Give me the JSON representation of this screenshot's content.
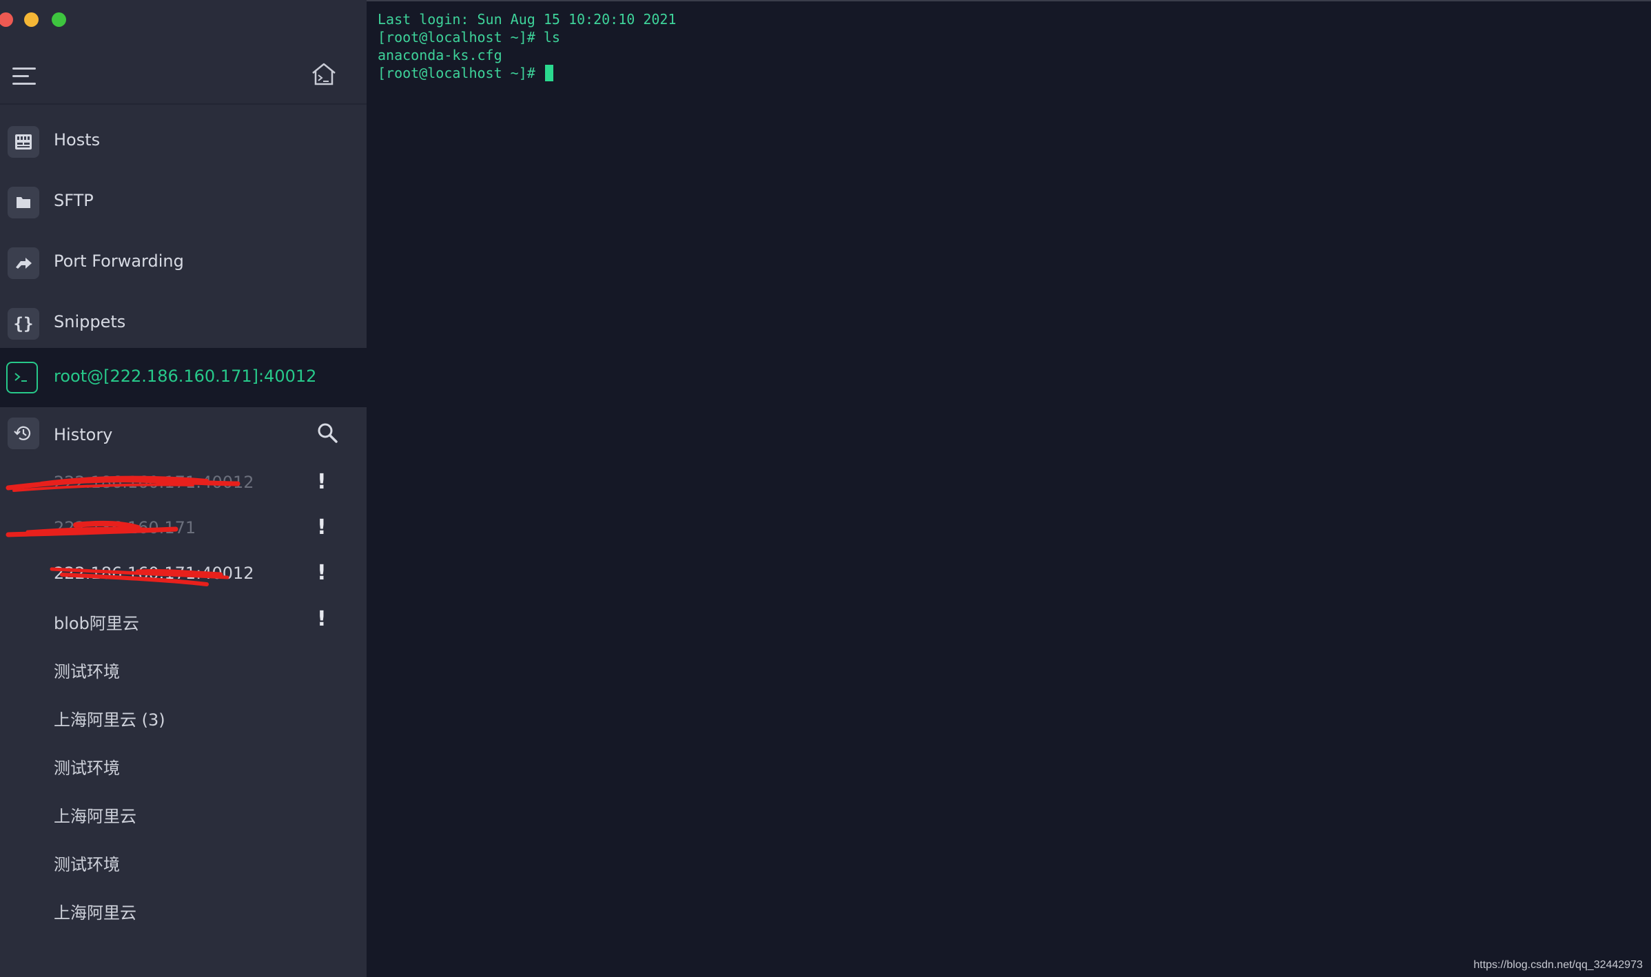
{
  "sidebar": {
    "nav": [
      {
        "label": "Hosts",
        "icon": "server-icon"
      },
      {
        "label": "SFTP",
        "icon": "folder-icon"
      },
      {
        "label": "Port Forwarding",
        "icon": "port-forward-icon"
      },
      {
        "label": "Snippets",
        "icon": "braces-icon"
      }
    ],
    "active_session": {
      "label": "root@[222.186.160.171]:40012",
      "icon": "terminal-icon"
    },
    "history": {
      "label": "History",
      "items": [
        {
          "label": "222.186.160.171:40012",
          "warning": "!",
          "redacted": true
        },
        {
          "label": "222.186.160.171",
          "warning": "!",
          "redacted": true
        },
        {
          "label": "222.186.160.171:40012",
          "warning": "!",
          "redacted": true
        },
        {
          "label": "blob阿里云",
          "warning": "!",
          "redacted": false
        },
        {
          "label": "测试环境",
          "warning": "",
          "redacted": false
        },
        {
          "label": "上海阿里云 (3)",
          "warning": "",
          "redacted": false
        },
        {
          "label": "测试环境",
          "warning": "",
          "redacted": false
        },
        {
          "label": "上海阿里云",
          "warning": "",
          "redacted": false
        },
        {
          "label": "测试环境",
          "warning": "",
          "redacted": false
        },
        {
          "label": "上海阿里云",
          "warning": "",
          "redacted": false
        }
      ]
    }
  },
  "terminal": {
    "lines": [
      "Last login: Sun Aug 15 10:20:10 2021",
      "[root@localhost ~]# ls",
      "anaconda-ks.cfg",
      "[root@localhost ~]# "
    ]
  },
  "watermark": "https://blog.csdn.net/qq_32442973",
  "colors": {
    "accent": "#27c98a",
    "sidebar_bg": "#2a2d3b",
    "terminal_bg": "#151826",
    "redaction": "#e8201c"
  }
}
